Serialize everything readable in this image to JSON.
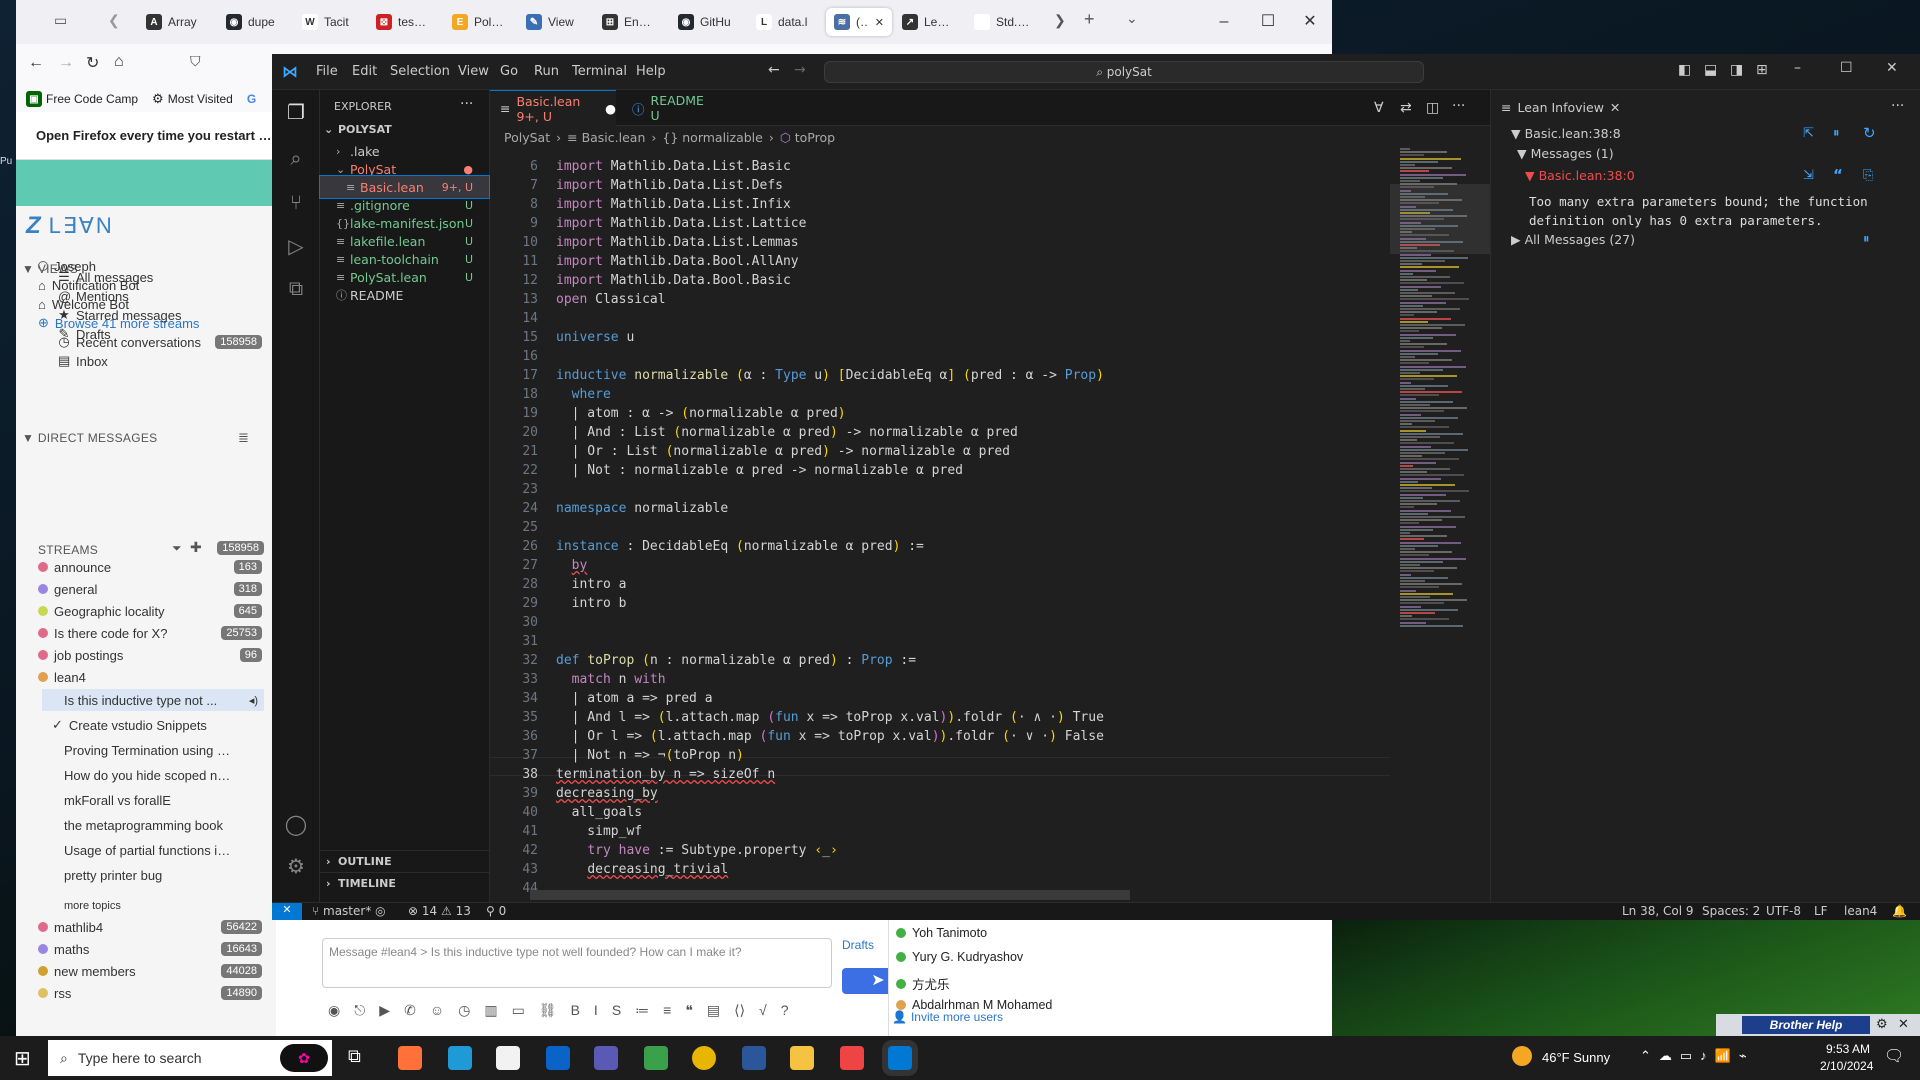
{
  "firefox": {
    "tabs": [
      {
        "label": "Array",
        "color": "#333333",
        "glyph": "A"
      },
      {
        "label": "dupe",
        "color": "#24292f",
        "glyph": "◉"
      },
      {
        "label": "Tacit",
        "color": "#ffffff",
        "glyph": "W"
      },
      {
        "label": "tese.p",
        "color": "#cc2222",
        "glyph": "⊠"
      },
      {
        "label": "Pollac",
        "color": "#f5a623",
        "glyph": "E"
      },
      {
        "label": "View",
        "color": "#3b6fb5",
        "glyph": "✎"
      },
      {
        "label": "Enhan",
        "color": "#333333",
        "glyph": "⊞"
      },
      {
        "label": "GitHu",
        "color": "#24292f",
        "glyph": "◉"
      },
      {
        "label": "data.l",
        "color": "#ffffff",
        "glyph": "L"
      },
      {
        "label": "(15",
        "color": "#4a6fa5",
        "glyph": "≋"
      },
      {
        "label": "Lean",
        "color": "#333333",
        "glyph": "↗"
      },
      {
        "label": "Std.Data.L",
        "color": "#ffffff",
        "glyph": ""
      }
    ],
    "bookmarks": [
      "Free Code Camp",
      "Most Visited"
    ],
    "notice": "Open Firefox every time you restart your c"
  },
  "zulip": {
    "logo": "L∃∀N",
    "views_header": "VIEWS",
    "views": [
      {
        "label": "Recent conversations",
        "icon": "clock-icon",
        "count": "158958"
      },
      {
        "label": "Inbox",
        "icon": "inbox-icon",
        "count": ""
      },
      {
        "label": "All messages",
        "icon": "list-icon",
        "count": ""
      },
      {
        "label": "Mentions",
        "icon": "at-icon",
        "count": ""
      },
      {
        "label": "Starred messages",
        "icon": "star-icon",
        "count": ""
      },
      {
        "label": "Drafts",
        "icon": "drafts-icon",
        "count": ""
      }
    ],
    "dm_header": "DIRECT MESSAGES",
    "dms": [
      "Joseph",
      "Notification Bot",
      "Welcome Bot"
    ],
    "streams_header": "STREAMS",
    "streams_count": "158958",
    "streams": [
      {
        "label": "announce",
        "count": "163",
        "color": "#e06a8a"
      },
      {
        "label": "general",
        "count": "318",
        "color": "#9a86e0"
      },
      {
        "label": "Geographic locality",
        "count": "645",
        "color": "#c8d850"
      },
      {
        "label": "Is there code for X?",
        "count": "25753",
        "color": "#e06a8a"
      },
      {
        "label": "job postings",
        "count": "96",
        "color": "#e06a8a"
      },
      {
        "label": "lean4",
        "count": "",
        "color": "#e0a050"
      }
    ],
    "topics": [
      "Is this inductive type not ...",
      "Create vstudio Snippets",
      "Proving Termination using Pa...",
      "How do you hide scoped nota...",
      "mkForall vs forallE",
      "the metaprogramming book",
      "Usage of partial functions in t...",
      "pretty printer bug"
    ],
    "more_topics": "more topics",
    "streams2": [
      {
        "label": "mathlib4",
        "count": "56422",
        "color": "#e06a8a"
      },
      {
        "label": "maths",
        "count": "16643",
        "color": "#9a86e0"
      },
      {
        "label": "new members",
        "count": "44028",
        "color": "#d0a030"
      },
      {
        "label": "rss",
        "count": "14890",
        "color": "#e0c060"
      }
    ],
    "browse": "Browse 41 more streams",
    "compose_placeholder": "Message #lean4 > Is this inductive type not well founded? How can I make it?",
    "drafts": "Drafts",
    "users": [
      "Yoh Tanimoto",
      "Yury G. Kudryashov",
      "方尤乐",
      "Abdalrhman M Mohamed"
    ],
    "invite": "Invite more users"
  },
  "vscode": {
    "menu": [
      "File",
      "Edit",
      "Selection",
      "View",
      "Go",
      "Run",
      "Terminal",
      "Help"
    ],
    "search": "polySat",
    "explorer_title": "EXPLORER",
    "root": "POLYSAT",
    "files": [
      {
        "name": ".lake",
        "status": "",
        "indent": 1,
        "kind": "folder-closed"
      },
      {
        "name": "PolySat",
        "status": "●",
        "indent": 1,
        "kind": "folder-open"
      },
      {
        "name": "Basic.lean",
        "status": "9+, U",
        "indent": 2,
        "kind": "file"
      },
      {
        "name": ".gitignore",
        "status": "U",
        "indent": 1,
        "kind": "file"
      },
      {
        "name": "lake-manifest.json",
        "status": "U",
        "indent": 1,
        "kind": "json"
      },
      {
        "name": "lakefile.lean",
        "status": "U",
        "indent": 1,
        "kind": "file"
      },
      {
        "name": "lean-toolchain",
        "status": "U",
        "indent": 1,
        "kind": "file"
      },
      {
        "name": "PolySat.lean",
        "status": "U",
        "indent": 1,
        "kind": "file"
      },
      {
        "name": "README",
        "status": "",
        "indent": 1,
        "kind": "info"
      }
    ],
    "outline": "OUTLINE",
    "timeline": "TIMELINE",
    "tabs": [
      {
        "label": "Basic.lean 9+, U",
        "active": true
      },
      {
        "label": "README U",
        "active": false
      }
    ],
    "breadcrumbs": [
      "PolySat",
      "Basic.lean",
      "{} normalizable",
      "toProp"
    ],
    "infoview": {
      "title": "Lean Infoview",
      "position": "Basic.lean:38:8",
      "messages_header": "Messages (1)",
      "error_loc": "Basic.lean:38:0",
      "error_text": "Too many extra parameters bound; the function definition only has 0 extra parameters.",
      "all_messages": "All Messages (27)"
    },
    "status": {
      "branch": "master*",
      "errors": "14",
      "warnings": "13",
      "ports": "0",
      "position": "Ln 38, Col 9",
      "spaces": "Spaces: 2",
      "encoding": "UTF-8",
      "eol": "LF",
      "language": "lean4"
    }
  },
  "taskbar": {
    "search": "Type here to search",
    "weather": "46°F  Sunny",
    "time": "9:53 AM",
    "date": "2/10/2024",
    "brother": "Brother Help"
  }
}
